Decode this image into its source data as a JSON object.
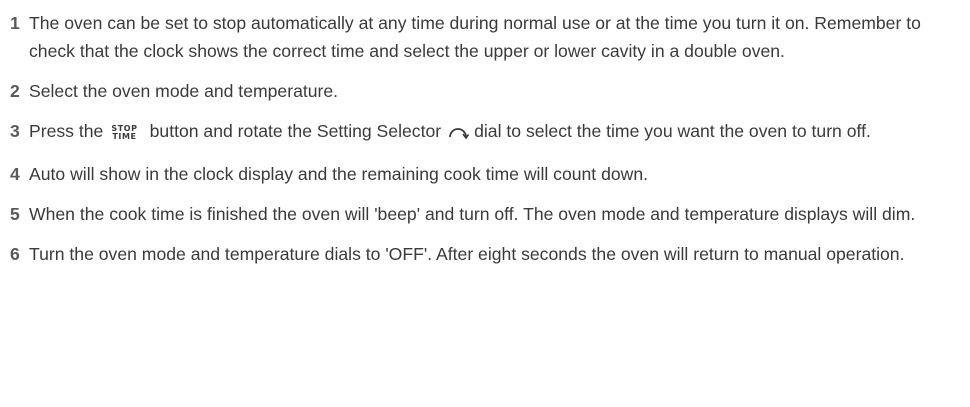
{
  "steps": [
    {
      "number": "1",
      "text": "The oven can be set to stop automatically at any time during normal use or at the time you turn it on.  Remember to check that the clock shows the correct time and select the upper or lower cavity in a double oven."
    },
    {
      "number": "2",
      "text": "Select the oven mode and temperature."
    },
    {
      "number": "3",
      "text_before": "Press the",
      "button_label_top": "STOP",
      "button_label_bottom": "TIME",
      "text_middle": "button and rotate the Setting Selector",
      "dial_icon": "setting-selector-dial-icon",
      "text_after": "dial to select the time you want the oven to turn off."
    },
    {
      "number": "4",
      "text": "Auto will show in the clock display and the remaining cook time will count down."
    },
    {
      "number": "5",
      "text": "When the cook time is finished the oven will 'beep' and turn off.  The oven mode and temperature displays will dim."
    },
    {
      "number": "6",
      "text": "Turn the oven mode and temperature dials to 'OFF'.  After eight seconds the oven will return to manual operation."
    }
  ]
}
